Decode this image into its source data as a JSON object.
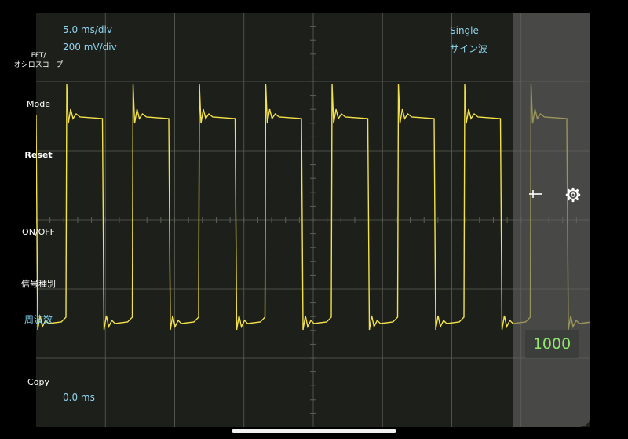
{
  "readouts": {
    "time_div": "5.0 ms/div",
    "volt_div": "200 mV/div",
    "trigger_mode": "Single",
    "waveform": "サイン波",
    "time_offset": "0.0 ms"
  },
  "panel": {
    "fft_scope": "FFT/\nオシロスコープ",
    "mode": "Mode",
    "reset": "Reset",
    "on_off": "ON/OFF",
    "signal_type": "信号種別",
    "frequency_label": "周波数",
    "frequency_value": "1000",
    "copy": "Copy"
  },
  "colors": {
    "screen_bg": "#1d1f1a",
    "grid": "#5c5f55",
    "trace": "#f2e14a",
    "readout_text": "#8fd4ee",
    "frequency_value": "#8ee86c"
  },
  "icons": [
    "cursor-crosshair-icon",
    "gear-icon"
  ]
}
